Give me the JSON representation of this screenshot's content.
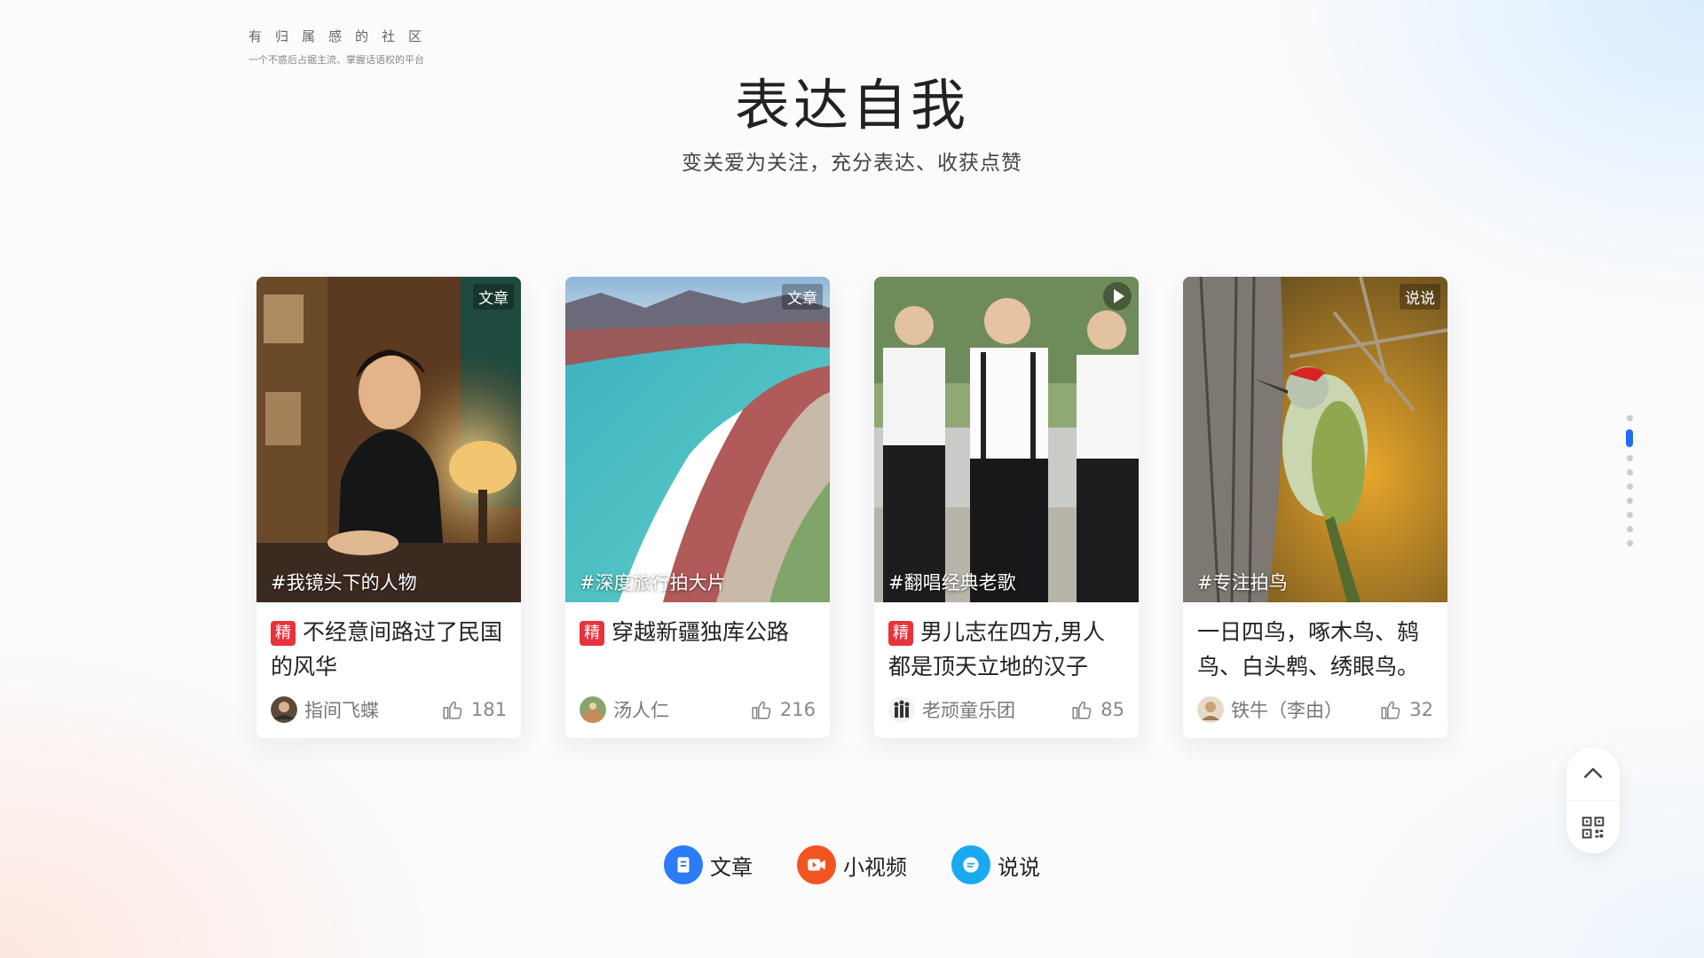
{
  "brand": {
    "title": "有归属感的社区",
    "subtitle": "一个不惑后占据主流、掌握话语权的平台"
  },
  "hero": {
    "title": "表达自我",
    "subtitle": "变关爱为关注，充分表达、收获点赞"
  },
  "cards": [
    {
      "type_label": "文章",
      "topic": "#我镜头下的人物",
      "featured_label": "精",
      "title": "不经意间路过了民国的风华",
      "author": "指间飞蝶",
      "likes": "181"
    },
    {
      "type_label": "文章",
      "topic": "#深度旅行拍大片",
      "featured_label": "精",
      "title": "穿越新疆独库公路",
      "author": "汤人仁",
      "likes": "216"
    },
    {
      "type_label": "",
      "topic": "#翻唱经典老歌",
      "featured_label": "精",
      "title": "男儿志在四方,男人都是顶天立地的汉子",
      "author": "老顽童乐团",
      "likes": "85"
    },
    {
      "type_label": "说说",
      "topic": "#专注拍鸟",
      "featured_label": "",
      "title": "一日四鸟，啄木鸟、鸫鸟、白头鹎、绣眼鸟。",
      "author": "铁牛（李由）",
      "likes": "32"
    }
  ],
  "pagination": {
    "total": 9,
    "active": 2
  },
  "tabs": [
    {
      "label": "文章",
      "icon": "article-icon",
      "color": "#2b7cf6"
    },
    {
      "label": "小视频",
      "icon": "video-icon",
      "color": "#f2541f"
    },
    {
      "label": "说说",
      "icon": "chat-icon",
      "color": "#1aa9f0"
    }
  ],
  "side_tools": [
    {
      "icon": "chevron-up-icon"
    },
    {
      "icon": "qrcode-icon"
    }
  ],
  "colors": {
    "accent": "#1f6ef0",
    "featured": "#e8323c"
  }
}
